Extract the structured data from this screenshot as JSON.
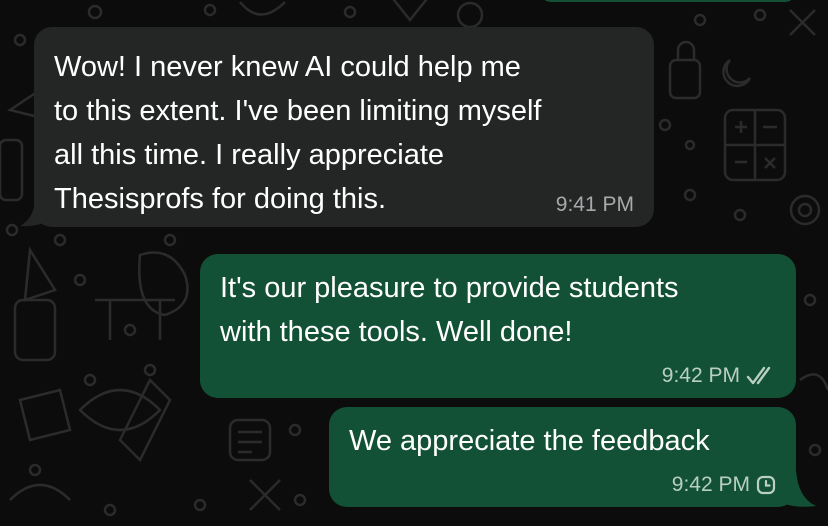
{
  "messages": [
    {
      "direction": "incoming",
      "text": "Wow! I never knew AI could help me\nto this extent. I've been limiting myself\nall this time. I really appreciate\nThesisprofs for doing this.",
      "time": "9:41 PM"
    },
    {
      "direction": "outgoing",
      "text": "It's our pleasure to provide students\nwith these tools. Well done!",
      "time": "9:42 PM",
      "status_icon": "double-check-icon"
    },
    {
      "direction": "outgoing",
      "text": "We appreciate the feedback",
      "time": "9:42 PM",
      "status_icon": "clock-pending-icon"
    }
  ],
  "colors": {
    "background": "#0c0c0c",
    "incoming_bubble": "#242626",
    "outgoing_bubble": "#125136",
    "incoming_time": "#a7a9aa",
    "outgoing_time": "#b8cfc2"
  }
}
